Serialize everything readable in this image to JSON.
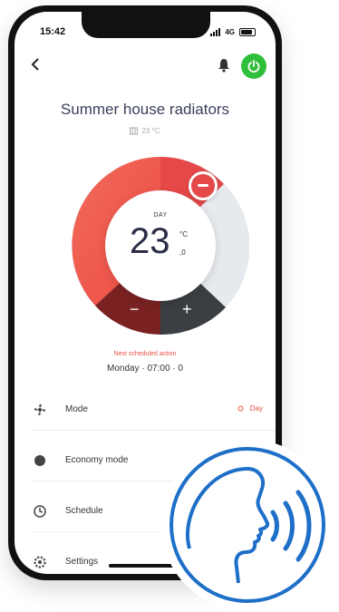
{
  "status_bar": {
    "time": "15:42",
    "network": "4G"
  },
  "header": {
    "title": "Summer house radiators",
    "subtitle": "23 °C"
  },
  "thermostat": {
    "period": "DAY",
    "temperature": "23",
    "unit": "°C",
    "decimal": ",0",
    "minus_label": "−",
    "plus_label": "+"
  },
  "next_action": {
    "label": "Next scheduled action",
    "value": "Monday · 07:00 · 0"
  },
  "menu": [
    {
      "label": "Mode",
      "value": "Day",
      "icon": "fan-icon"
    },
    {
      "label": "Economy mode",
      "icon": "eco-icon"
    },
    {
      "label": "Schedule",
      "icon": "clock-icon"
    },
    {
      "label": "Settings",
      "icon": "gear-icon"
    }
  ],
  "colors": {
    "accent_red": "#e54848",
    "power_green": "#2fbf3a",
    "voice_blue": "#1e6fc8"
  },
  "overlay": {
    "icon": "voice-assistant-icon"
  }
}
